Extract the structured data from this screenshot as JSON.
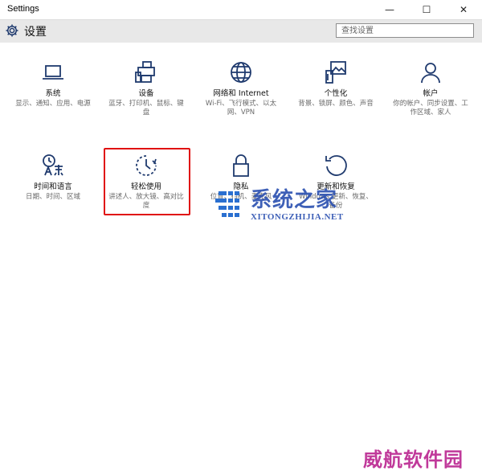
{
  "window": {
    "title": "Settings",
    "controls": [
      "—",
      "☐",
      "✕"
    ]
  },
  "header": {
    "title": "设置",
    "search_placeholder": "查找设置"
  },
  "tiles": [
    {
      "name": "系统",
      "desc": "显示、通知、应用、电源",
      "icon": "laptop-icon"
    },
    {
      "name": "设备",
      "desc": "蓝牙、打印机、鼠标、键盘",
      "icon": "devices-icon"
    },
    {
      "name": "网络和 Internet",
      "desc": "Wi-Fi、飞行模式、以太网、VPN",
      "icon": "globe-icon"
    },
    {
      "name": "个性化",
      "desc": "背景、锁屏、颜色、声音",
      "icon": "personalization-icon"
    },
    {
      "name": "帐户",
      "desc": "你的帐户、同步设置、工作区域、家人",
      "icon": "person-icon"
    },
    {
      "name": "时间和语言",
      "desc": "日期、时间、区域",
      "icon": "time-language-icon"
    },
    {
      "name": "轻松使用",
      "desc": "讲述人、放大镜、高对比度",
      "icon": "ease-of-access-icon",
      "selected": true
    },
    {
      "name": "隐私",
      "desc": "位置、相机、麦克风",
      "icon": "lock-icon"
    },
    {
      "name": "更新和恢复",
      "desc": "Windows 更新、恢复、备份",
      "icon": "update-icon"
    }
  ],
  "watermark": {
    "brand": "系统之家",
    "url": "XITONGZHIJIA.NET"
  },
  "corner_watermark": "威航软件园",
  "colors": {
    "accent": "#1f3a6e",
    "highlight": "#e01010",
    "header_bg": "#e8e8e8"
  }
}
